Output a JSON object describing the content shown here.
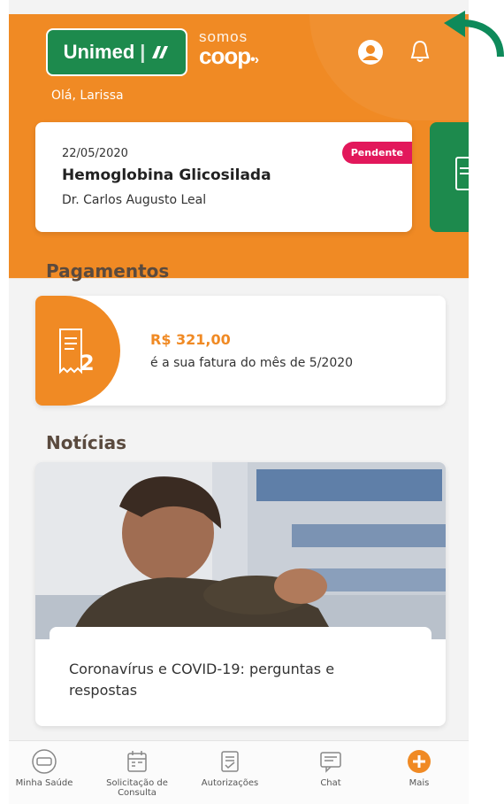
{
  "header": {
    "brand_name": "Unimed",
    "campaign_small": "somos",
    "campaign_big": "coop",
    "greeting": "Olá, Larissa",
    "icons": [
      "profile-icon",
      "bell-icon"
    ]
  },
  "appointment": {
    "date": "22/05/2020",
    "exam": "Hemoglobina Glicosilada",
    "doctor": "Dr. Carlos Augusto Leal",
    "status": "Pendente"
  },
  "payments": {
    "section_title": "Pagamentos",
    "amount": "R$ 321,00",
    "description": "é a sua fatura do mês de 5/2020"
  },
  "news": {
    "section_title": "Notícias",
    "headline": "Coronavírus e COVID-19: perguntas e respostas"
  },
  "bottom_nav": {
    "items": [
      {
        "label": "Minha Saúde",
        "icon": "health-record-icon"
      },
      {
        "label": "Solicitação de Consulta",
        "icon": "calendar-request-icon"
      },
      {
        "label": "Autorizações",
        "icon": "document-check-icon"
      },
      {
        "label": "Chat",
        "icon": "chat-icon"
      },
      {
        "label": "Mais",
        "icon": "plus-circle-icon"
      }
    ]
  },
  "colors": {
    "brand_orange": "#f08a24",
    "brand_green": "#1d8a4d",
    "pending_pink": "#e2185b",
    "annotation_arrow": "#0e8a5a"
  }
}
